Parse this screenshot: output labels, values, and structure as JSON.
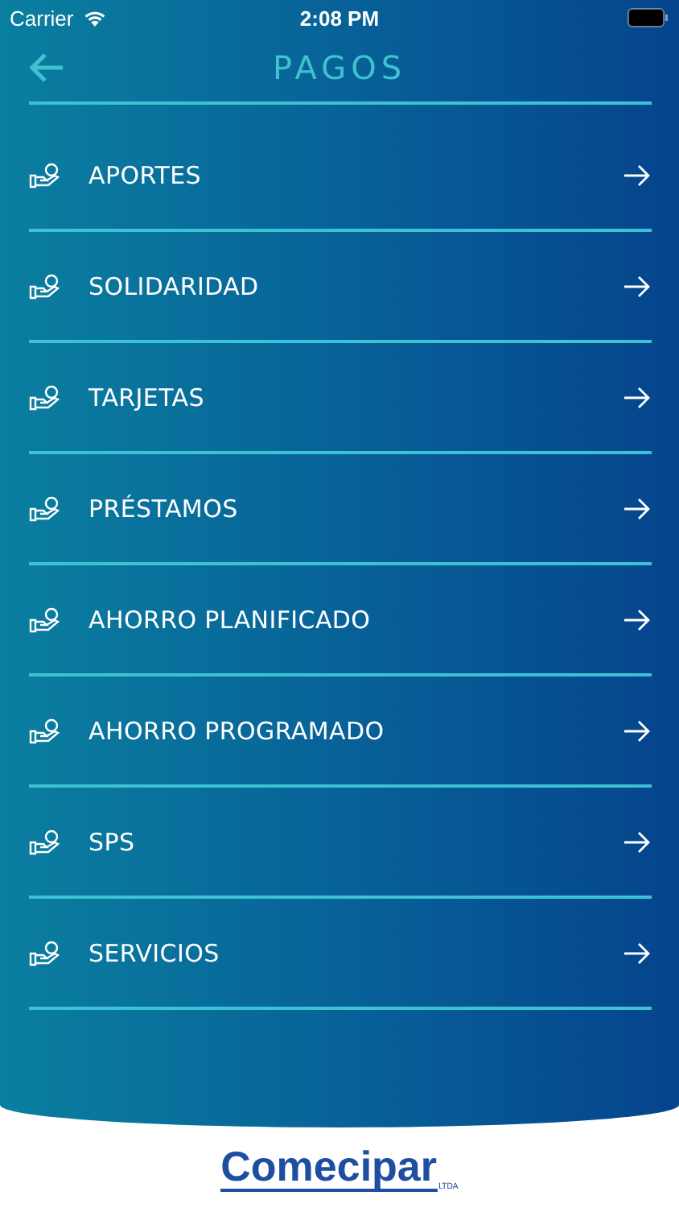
{
  "status_bar": {
    "carrier": "Carrier",
    "time": "2:08 PM"
  },
  "header": {
    "title": "PAGOS"
  },
  "items": [
    {
      "label": "APORTES"
    },
    {
      "label": "SOLIDARIDAD"
    },
    {
      "label": "TARJETAS"
    },
    {
      "label": "PRÉSTAMOS"
    },
    {
      "label": "AHORRO PLANIFICADO"
    },
    {
      "label": "AHORRO PROGRAMADO"
    },
    {
      "label": "SPS"
    },
    {
      "label": "SERVICIOS"
    }
  ],
  "footer": {
    "logo": "Comecipar",
    "logo_suffix": "LTDA"
  }
}
